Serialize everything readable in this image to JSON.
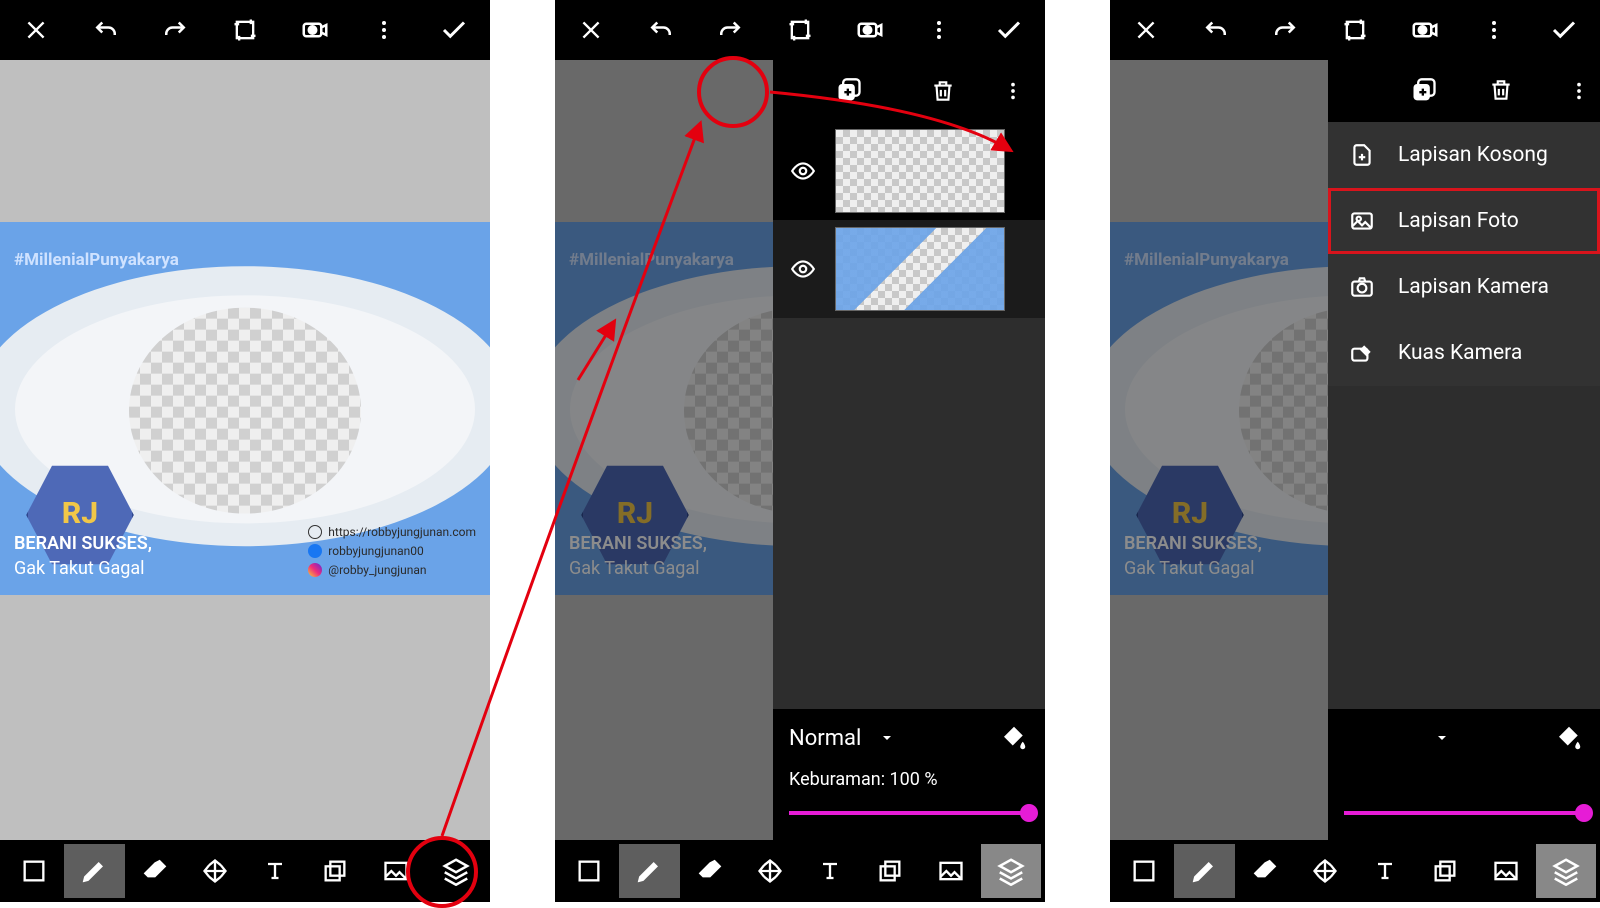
{
  "frame": {
    "hashtag": "#MillenialPunyakarya",
    "line1": "BERANI SUKSES,",
    "line2": "Gak Takut Gagal",
    "logo": "RJ",
    "socials": {
      "web": "https://robbyjungjunan.com",
      "fb": "robbyjungjunan00",
      "ig": "@robby_jungjunan"
    }
  },
  "layers_panel": {
    "blend_mode": "Normal",
    "opacity_label": "Keburaman: 100 %",
    "opacity_value": 100
  },
  "add_menu": {
    "items": [
      {
        "label": "Lapisan Kosong",
        "icon": "file-plus"
      },
      {
        "label": "Lapisan Foto",
        "icon": "image",
        "highlight": true
      },
      {
        "label": "Lapisan Kamera",
        "icon": "camera"
      },
      {
        "label": "Kuas Kamera",
        "icon": "brush-camera"
      }
    ]
  }
}
